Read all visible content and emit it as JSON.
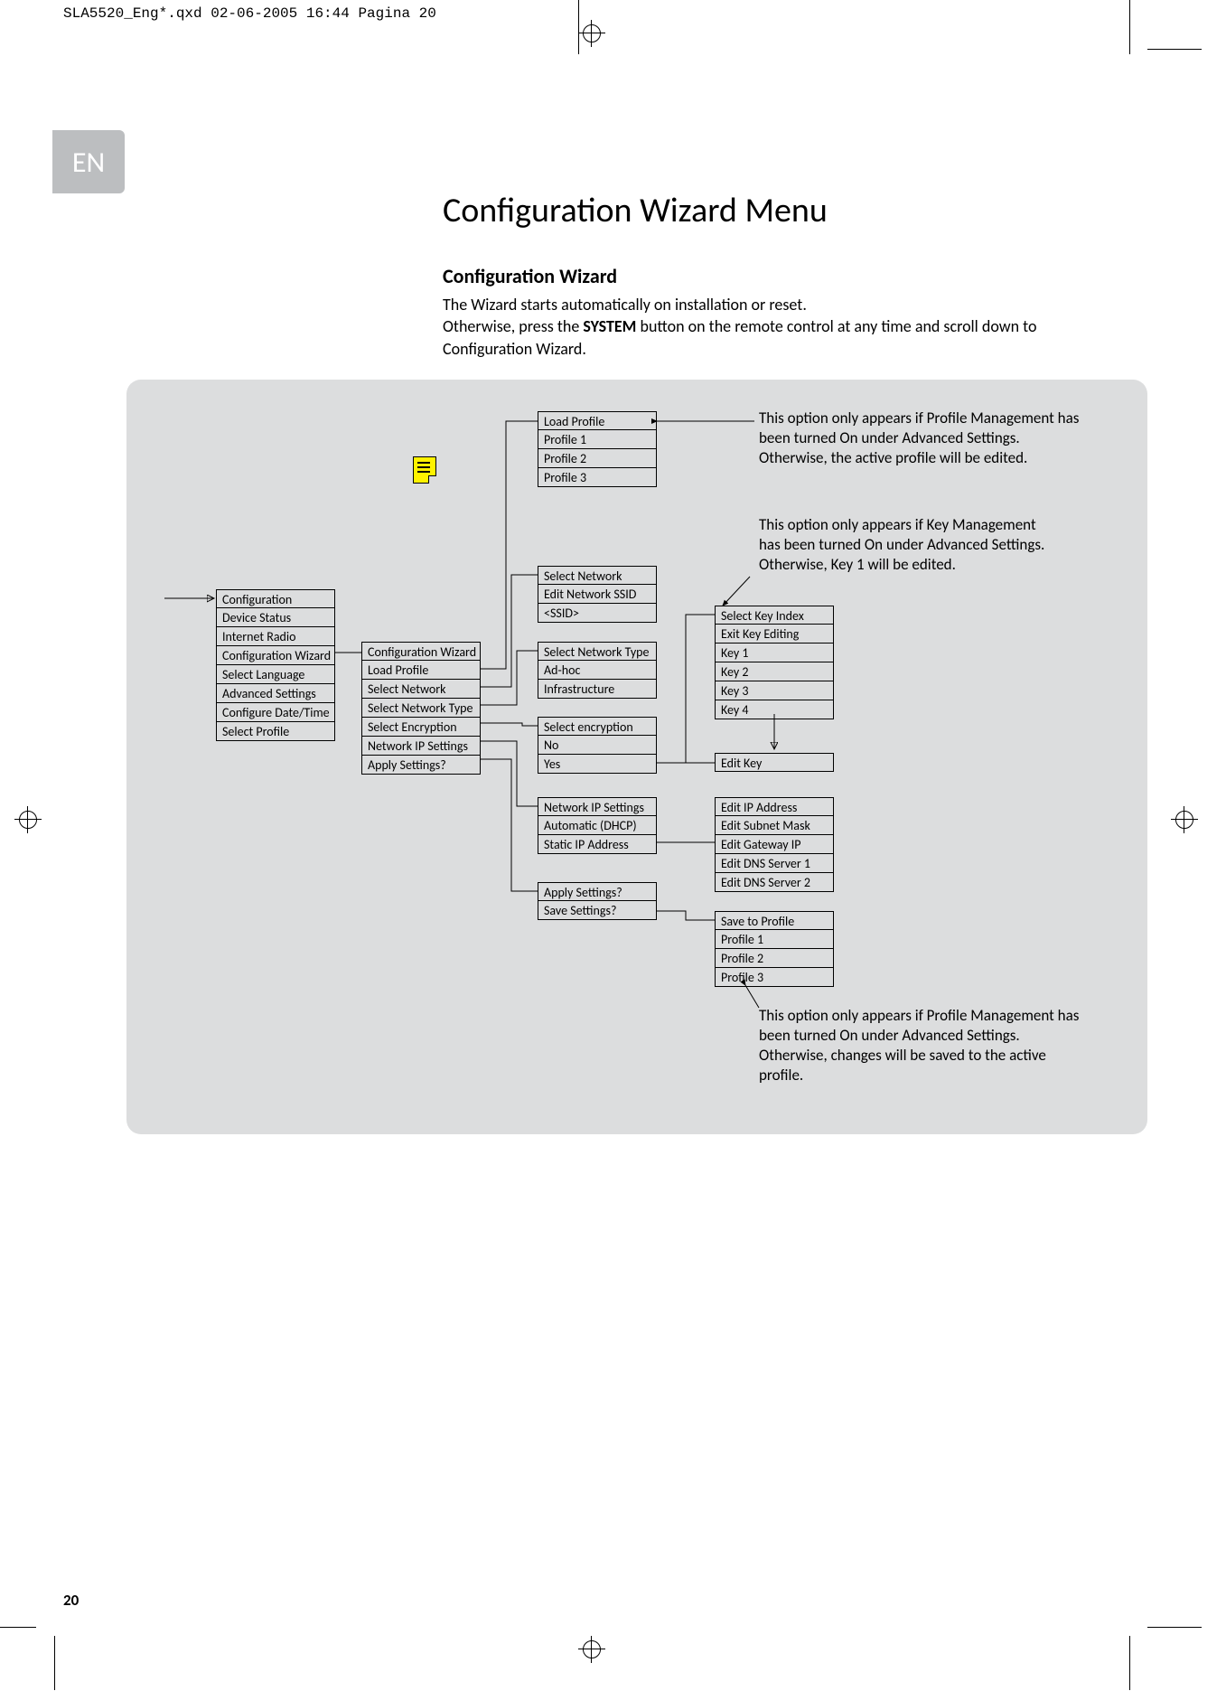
{
  "print_header": "SLA5520_Eng*.qxd  02-06-2005  16:44  Pagina 20",
  "lang_tab": "EN",
  "title": "Configuration Wizard Menu",
  "subtitle": "Configuration Wizard",
  "intro_line1": "The Wizard starts automatically on installation or reset.",
  "intro_line2a": "Otherwise, press the ",
  "intro_system": "SYSTEM",
  "intro_line2b": " button on the remote control at any time and scroll down to Configuration Wizard.",
  "page_number": "20",
  "menu_config": {
    "h": "Configuration",
    "items": [
      "Device Status",
      "Internet Radio",
      "Configuration Wizard",
      "Select Language",
      "Advanced Settings",
      "Configure Date/Time",
      "Select Profile"
    ]
  },
  "menu_wizard": {
    "h": "Configuration Wizard",
    "items": [
      "Load Profile",
      "Select Network",
      "Select Network Type",
      "Select Encryption",
      "Network IP Settings",
      "Apply Settings?"
    ]
  },
  "menu_load_profile": {
    "h": "Load Profile",
    "items": [
      "Profile 1",
      "Profile 2",
      "Profile 3"
    ]
  },
  "menu_sel_network": {
    "h": "Select Network",
    "items": [
      "Edit Network SSID",
      "<SSID>"
    ]
  },
  "menu_net_type": {
    "h": "Select Network Type",
    "items": [
      "Ad-hoc",
      "Infrastructure"
    ]
  },
  "menu_encryption": {
    "h": "Select encryption",
    "items": [
      "No",
      "Yes"
    ]
  },
  "menu_ip": {
    "h": "Network IP Settings",
    "items": [
      "Automatic (DHCP)",
      "Static IP Address"
    ]
  },
  "menu_apply": {
    "h": "Apply Settings?",
    "items": [
      "Save Settings?"
    ]
  },
  "menu_key_index": {
    "h": "Select Key Index",
    "items": [
      "Exit Key Editing",
      "Key 1",
      "Key 2",
      "Key 3",
      "Key 4"
    ]
  },
  "menu_edit_key": {
    "h": "Edit Key"
  },
  "menu_ip_edit": {
    "items": [
      "Edit IP Address",
      "Edit Subnet Mask",
      "Edit Gateway IP",
      "Edit DNS Server 1",
      "Edit DNS Server 2"
    ]
  },
  "menu_save_profile": {
    "h": "Save to Profile",
    "items": [
      "Profile 1",
      "Profile 2",
      "Profile 3"
    ]
  },
  "annot_load_profile": "This option only appears if Profile Management has been turned On under Advanced Settings. Otherwise, the active profile will be edited.",
  "annot_key": "This option only appears if Key Management has been turned On under Advanced Settings. Otherwise, Key 1 will be edited.",
  "annot_save_profile": "This option only appears if Profile Management has been turned On under Advanced Settings. Otherwise, changes will be saved to the active profile."
}
